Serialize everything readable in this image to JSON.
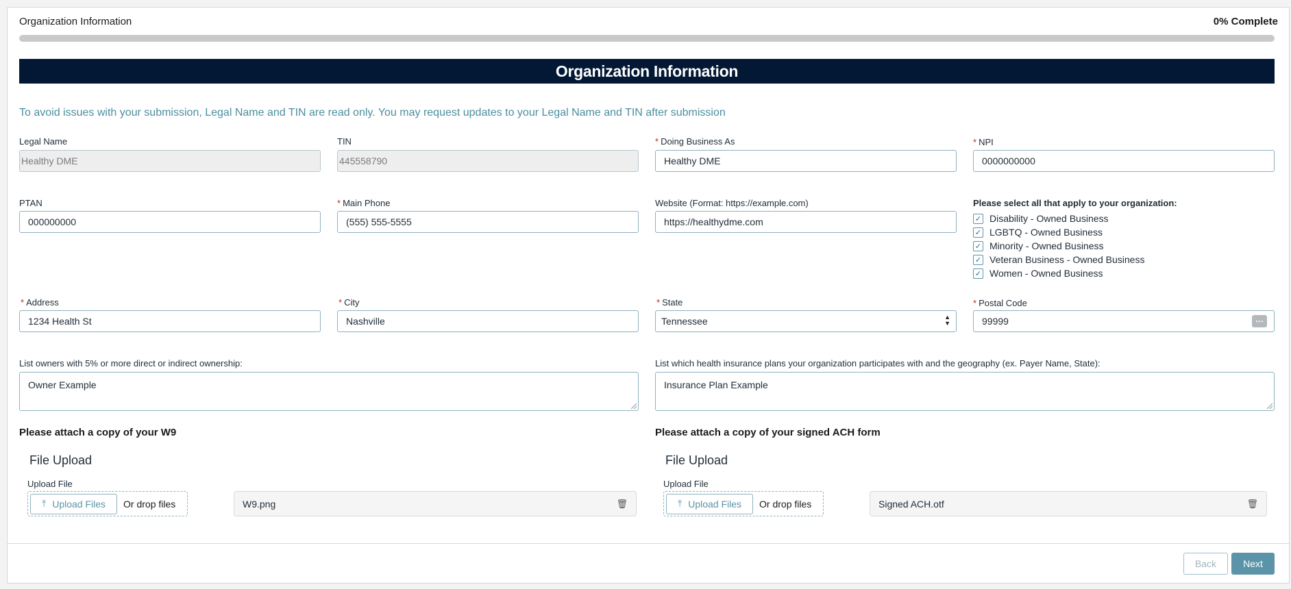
{
  "header": {
    "title": "Organization Information",
    "progress_text": "0% Complete",
    "progress_value": 0
  },
  "section_title": "Organization Information",
  "notice": "To avoid issues with your submission, Legal Name and TIN are read only. You may request updates to your Legal Name and TIN after submission",
  "fields": {
    "legal_name": {
      "label": "Legal Name",
      "value": "Healthy DME"
    },
    "tin": {
      "label": "TIN",
      "value": "445558790"
    },
    "dba": {
      "label": "Doing Business As",
      "value": "Healthy DME"
    },
    "npi": {
      "label": "NPI",
      "value": "0000000000"
    },
    "ptan": {
      "label": "PTAN",
      "value": "000000000"
    },
    "main_phone": {
      "label": "Main Phone",
      "value": "(555) 555-5555"
    },
    "website": {
      "label": "Website (Format: https://example.com)",
      "value": "https://healthydme.com"
    },
    "address": {
      "label": "Address",
      "value": "1234 Health St"
    },
    "city": {
      "label": "City",
      "value": "Nashville"
    },
    "state": {
      "label": "State",
      "value": "Tennessee"
    },
    "postal_code": {
      "label": "Postal Code",
      "value": "99999"
    },
    "owners": {
      "label": "List owners with 5% or more direct or indirect ownership:",
      "value": "Owner Example"
    },
    "insurance": {
      "label": "List which health insurance plans your organization participates with and the geography (ex. Payer Name, State):",
      "value": "Insurance Plan Example"
    }
  },
  "checks": {
    "title": "Please select all that apply to your organization:",
    "items": [
      {
        "label": "Disability - Owned Business",
        "checked": true
      },
      {
        "label": "LGBTQ - Owned Business",
        "checked": true
      },
      {
        "label": "Minority - Owned Business",
        "checked": true
      },
      {
        "label": "Veteran Business - Owned Business",
        "checked": true
      },
      {
        "label": "Women - Owned Business",
        "checked": true
      }
    ]
  },
  "w9": {
    "title": "Please attach a copy of your W9",
    "upload_title": "File Upload",
    "upload_label": "Upload File",
    "button": "Upload Files",
    "drop": "Or drop files",
    "file": "W9.png"
  },
  "ach": {
    "title": "Please attach a copy of your signed ACH form",
    "upload_title": "File Upload",
    "upload_label": "Upload File",
    "button": "Upload Files",
    "drop": "Or drop files",
    "file": "Signed ACH.otf"
  },
  "footer": {
    "back": "Back",
    "next": "Next"
  },
  "icons": {
    "upload": "upload-icon",
    "trash": "trash-icon",
    "check": "check-icon",
    "ellipsis": "ellipsis-icon"
  },
  "colors": {
    "header_bg": "#021834",
    "accent": "#5b94a8",
    "notice": "#4a8ea0",
    "required": "#c0271f"
  }
}
